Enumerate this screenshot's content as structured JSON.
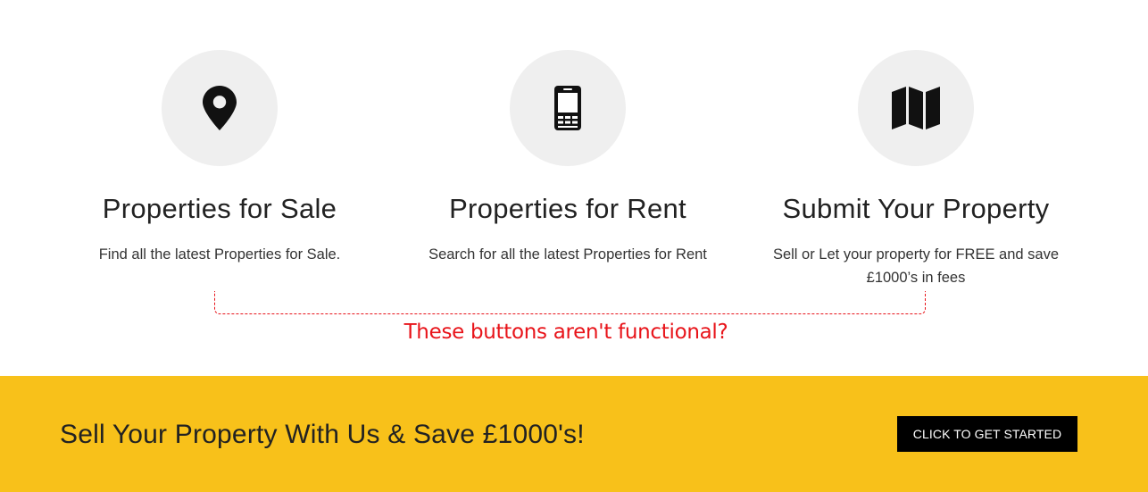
{
  "features": [
    {
      "icon": "map-pin-icon",
      "title": "Properties for Sale",
      "description": "Find all the latest Properties for Sale."
    },
    {
      "icon": "mobile-phone-icon",
      "title": "Properties for Rent",
      "description": "Search for all the latest Properties for Rent"
    },
    {
      "icon": "folded-map-icon",
      "title": "Submit Your Property",
      "description": "Sell or Let your property for FREE and save £1000’s in fees"
    }
  ],
  "annotation": {
    "text": "These buttons aren't functional?",
    "color": "#e8141a"
  },
  "banner": {
    "text": "Sell Your Property With Us & Save £1000's!",
    "button_label": "CLICK TO GET STARTED",
    "background_color": "#f8c11a",
    "button_color": "#000000"
  },
  "colors": {
    "icon_circle": "#efefef",
    "icon": "#111111"
  }
}
